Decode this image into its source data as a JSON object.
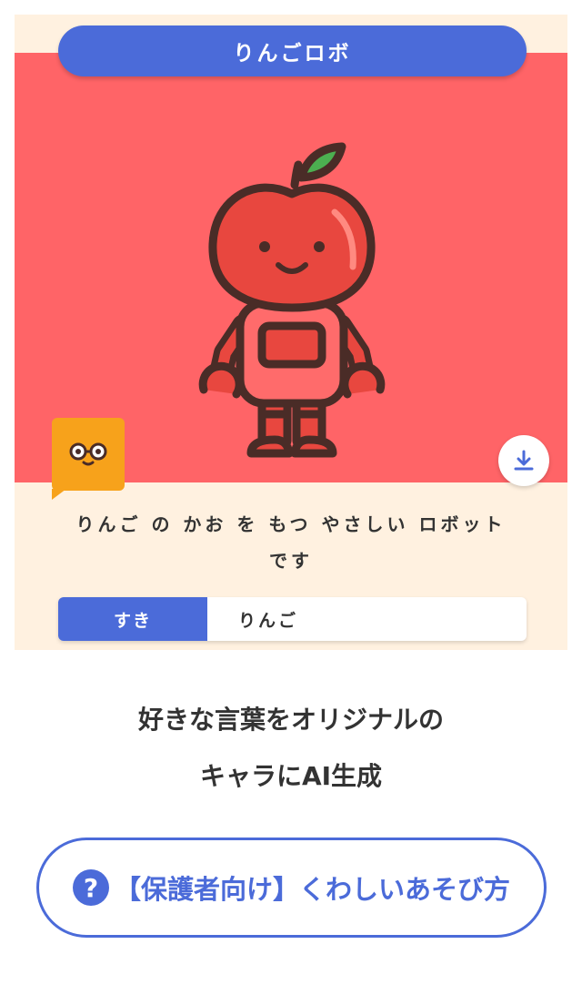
{
  "card": {
    "title": "りんごロボ",
    "description_line1": "りんご の かお を もつ やさしい ロボット",
    "description_line2": "です",
    "tag_label": "すき",
    "tag_value": "りんご",
    "icons": [
      "download-icon",
      "mascot-glasses-icon"
    ],
    "colors": {
      "image_bg": "#ff6467",
      "card_bg": "#fff1e0",
      "accent": "#4b6bd9",
      "mascot": "#f7a21b"
    }
  },
  "headline": {
    "line1": "好きな言葉をオリジナルの",
    "line2": "キャラにAI生成"
  },
  "howto": {
    "icon_glyph": "?",
    "label": "【保護者向け】くわしいあそび方"
  }
}
